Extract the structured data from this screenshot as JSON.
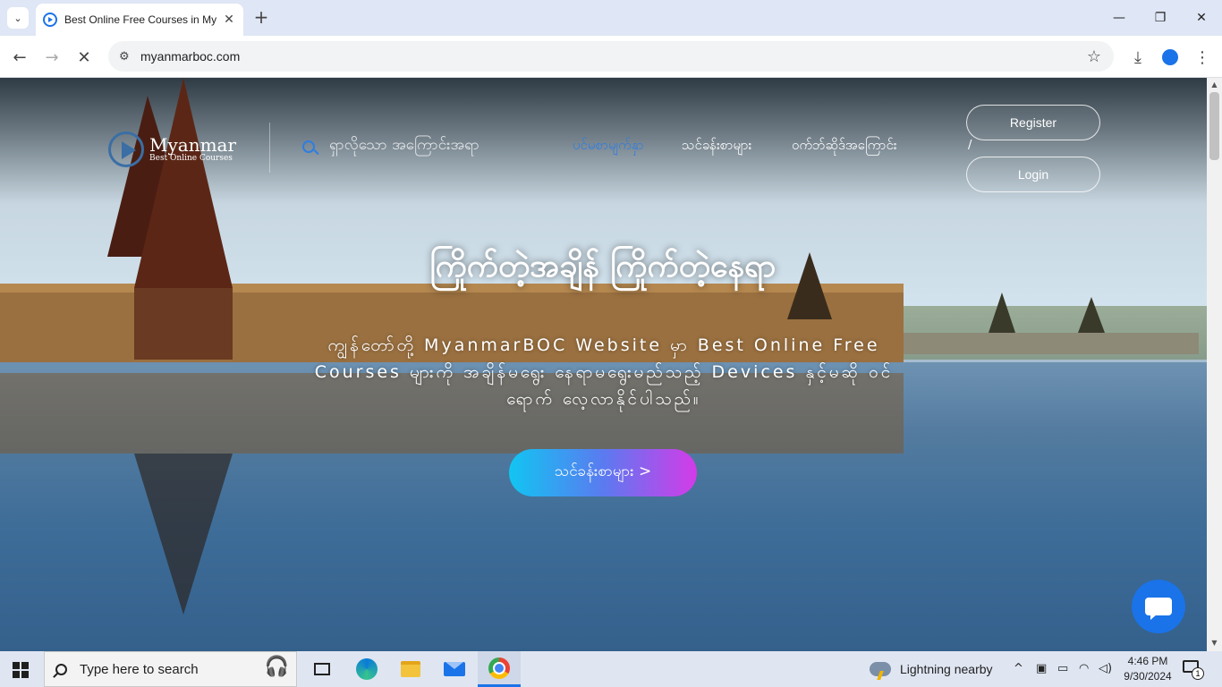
{
  "browser": {
    "tab_title": "Best Online Free Courses in My",
    "url": "myanmarboc.com"
  },
  "site": {
    "logo_name": "Myanmar",
    "logo_sub": "Best Online Courses",
    "search_placeholder": "ရှာလိုသော အကြောင်းအရာ",
    "nav": [
      {
        "label": "ပင်မစာမျက်နှာ",
        "active": true
      },
      {
        "label": "သင်ခန်းစာများ",
        "active": false
      },
      {
        "label": "ဝက်ဘ်ဆိုဒ်အကြောင်း",
        "active": false
      }
    ],
    "register_label": "Register",
    "separator": "/",
    "login_label": "Login",
    "hero_title": "ကြိုက်တဲ့အချိန် ကြိုက်တဲ့နေရာ",
    "hero_desc": "ကျွန်တော်တို့ MyanmarBOC Website မှာ Best Online Free Courses များကို အချိန်မရွေး နေရာမရွေးမည်သည့် Devices နှင့်မဆို ဝင်ရောက် လေ့လာနိုင်ပါသည်။",
    "hero_button": "သင်ခန်းစာများ >"
  },
  "taskbar": {
    "search_placeholder": "Type here to search",
    "weather": "Lightning nearby",
    "time": "4:46 PM",
    "date": "9/30/2024",
    "notification_count": "1"
  },
  "icons": {
    "back": "arrow-left-icon",
    "forward": "arrow-right-icon",
    "stop": "close-icon",
    "bookmark": "star-icon",
    "download": "download-icon",
    "profile": "person-icon",
    "menu": "kebab-icon"
  },
  "colors": {
    "accent": "#2f7de1",
    "chrome_tabstrip": "#dfe6f5",
    "taskbar": "#dfe6f2",
    "chat": "#1a73e8"
  }
}
